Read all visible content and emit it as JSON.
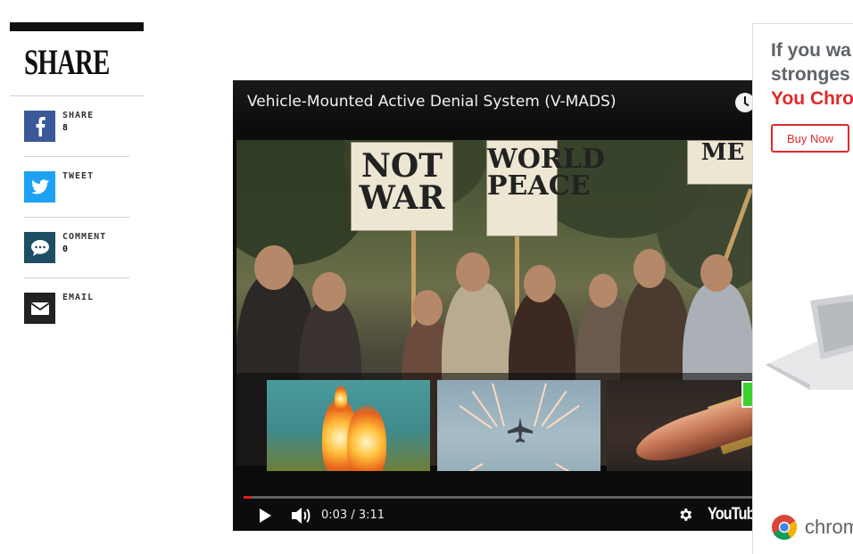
{
  "share": {
    "heading": "SHARE",
    "items": [
      {
        "id": "facebook",
        "label": "SHARE",
        "count": "8",
        "icon": "facebook-icon",
        "color": "#3b5998"
      },
      {
        "id": "twitter",
        "label": "TWEET",
        "count": "",
        "icon": "twitter-bird-icon",
        "color": "#1da1f2"
      },
      {
        "id": "comment",
        "label": "COMMENT",
        "count": "0",
        "icon": "comment-bubble-icon",
        "color": "#1d4e63"
      },
      {
        "id": "email",
        "label": "EMAIL",
        "count": "",
        "icon": "envelope-icon",
        "color": "#222222"
      }
    ]
  },
  "video": {
    "title": "Vehicle-Mounted Active Denial System (V-MADS)",
    "time_current": "0:03",
    "time_total": "3:11",
    "time_display": "0:03 / 3:11",
    "progress": 0.016,
    "sign_texts": [
      "NOT WAR",
      "WORLD PEACE",
      "ME"
    ],
    "logo": "YouTube",
    "icons": [
      "watch-later-clock-icon",
      "play-icon",
      "volume-icon",
      "settings-gear-icon"
    ],
    "accent_color": "#e01b1b"
  },
  "ad": {
    "headline_line1": "If you wa",
    "headline_line2": "stronges",
    "headline_line3": "You Chro",
    "buy_label": "Buy Now",
    "brand_text": "chrom",
    "accent_color": "#e02a2a"
  }
}
